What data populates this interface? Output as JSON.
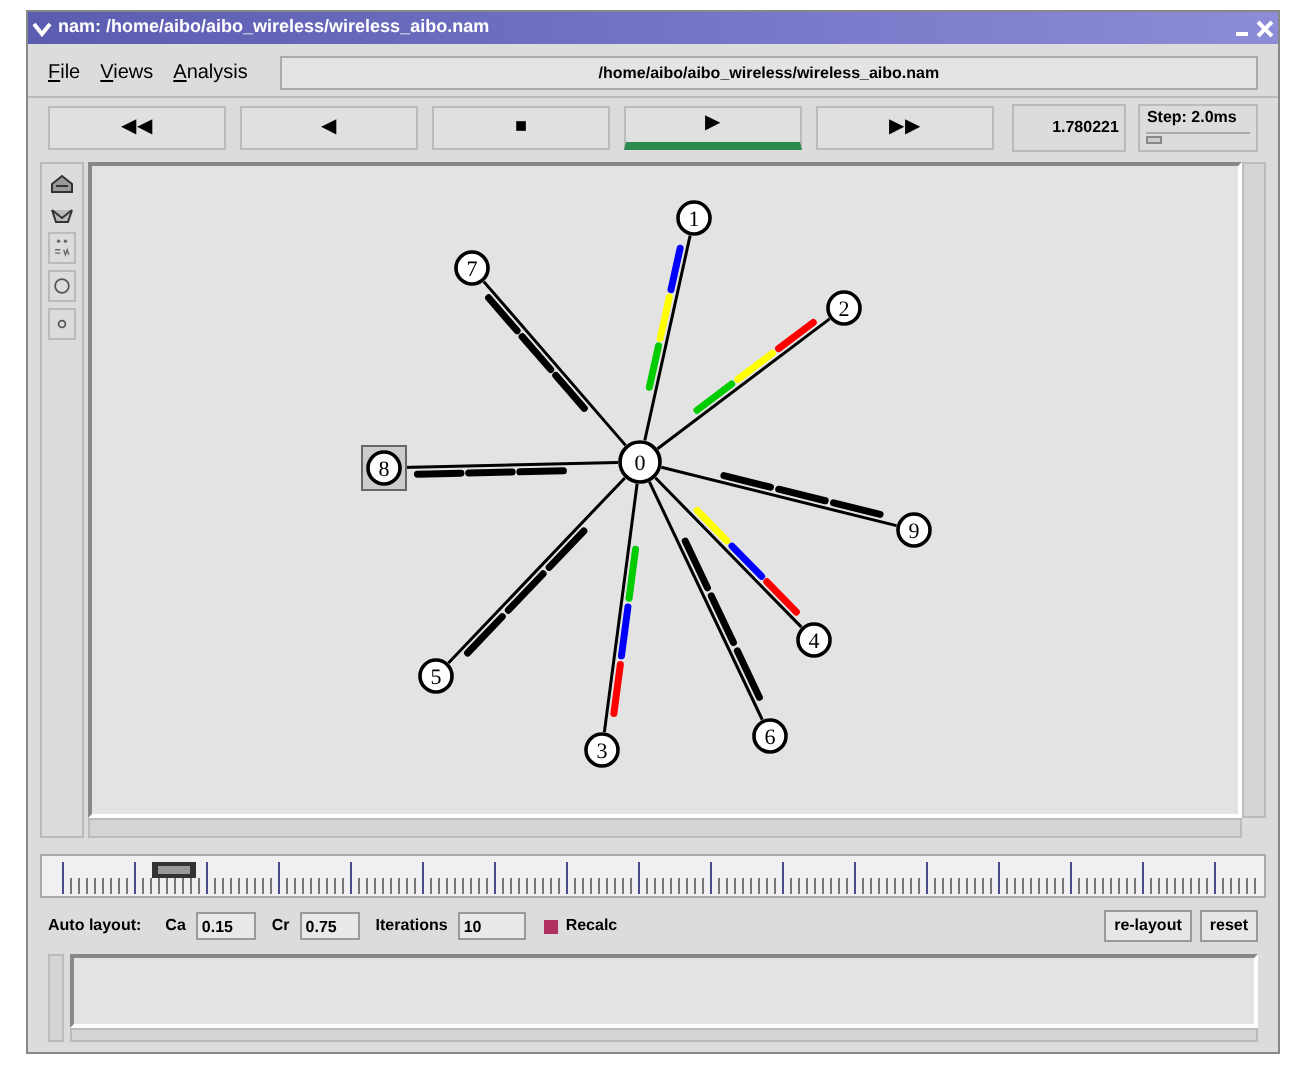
{
  "window": {
    "title": "nam: /home/aibo/aibo_wireless/wireless_aibo.nam"
  },
  "menu": [
    "File",
    "Views",
    "Analysis"
  ],
  "file_path": "/home/aibo/aibo_wireless/wireless_aibo.nam",
  "controls": [
    {
      "label": "◀◀",
      "selected": false
    },
    {
      "label": "◀",
      "selected": false
    },
    {
      "label": "■",
      "selected": false
    },
    {
      "label": "▶",
      "selected": true
    },
    {
      "label": "▶▶",
      "selected": false
    }
  ],
  "time": "1.780221",
  "step": {
    "label": "Step: 2.0ms",
    "level": 0.15
  },
  "nodes": [
    {
      "label": "0",
      "kind": "circle"
    },
    {
      "label": "1",
      "kind": "circle"
    },
    {
      "label": "2",
      "kind": "circle"
    },
    {
      "label": "3",
      "kind": "circle"
    },
    {
      "label": "4",
      "kind": "circle"
    },
    {
      "label": "5",
      "kind": "circle"
    },
    {
      "label": "6",
      "kind": "circle"
    },
    {
      "label": "7",
      "kind": "circle"
    },
    {
      "label": "8",
      "kind": "square"
    },
    {
      "label": "9",
      "kind": "circle"
    }
  ],
  "links": [
    {
      "packets": [
        {
          "color": "#00cc00"
        },
        {
          "color": "#ffff00"
        },
        {
          "color": "#0000ff"
        }
      ]
    },
    {
      "packets": [
        {
          "color": "#00cc00"
        },
        {
          "color": "#ffff00"
        },
        {
          "color": "#ff0000"
        }
      ]
    },
    {
      "packets": [
        {
          "color": "#00cc00"
        },
        {
          "color": "#0000ff"
        },
        {
          "color": "#ff0000"
        }
      ]
    },
    {
      "packets": [
        {
          "color": "#ffff00"
        },
        {
          "color": "#0000ff"
        },
        {
          "color": "#ff0000"
        }
      ]
    },
    {
      "packets": [
        {
          "color": "#000000"
        },
        {
          "color": "#000000"
        },
        {
          "color": "#000000"
        }
      ]
    },
    {
      "packets": [
        {
          "color": "#000000"
        },
        {
          "color": "#000000"
        },
        {
          "color": "#000000"
        }
      ]
    },
    {
      "packets": [
        {
          "color": "#000000"
        },
        {
          "color": "#000000"
        },
        {
          "color": "#000000"
        }
      ]
    },
    {
      "packets": [
        {
          "color": "#000000"
        },
        {
          "color": "#000000"
        },
        {
          "color": "#000000"
        }
      ]
    },
    {
      "packets": [
        {
          "color": "#000000"
        },
        {
          "color": "#000000"
        },
        {
          "color": "#000000"
        }
      ]
    }
  ],
  "auto_layout": {
    "label": "Auto layout:",
    "fields": [
      {
        "label": "Ca",
        "value": "0.15"
      },
      {
        "label": "Cr",
        "value": "0.75"
      },
      {
        "label": "Iterations",
        "value": "10"
      }
    ],
    "recalc": {
      "label": "Recalc",
      "checked": true
    }
  },
  "buttons": [
    "re-layout",
    "reset"
  ]
}
